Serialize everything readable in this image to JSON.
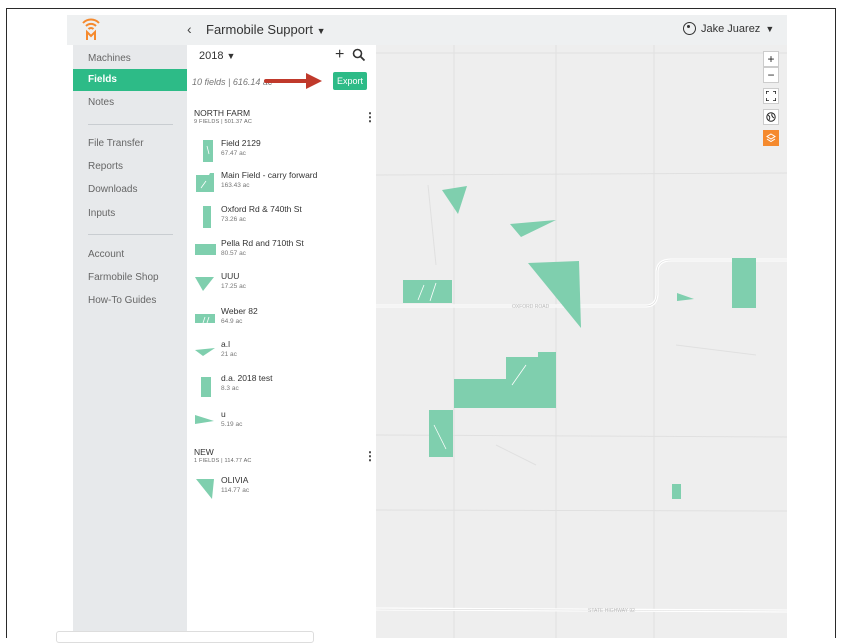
{
  "header": {
    "org_name": "Farmobile Support",
    "user_name": "Jake Juarez",
    "back_icon": "chevron-left-icon",
    "brand_color": "#f58a2e"
  },
  "sidebar": {
    "items": [
      {
        "label": "Machines",
        "active": false
      },
      {
        "label": "Fields",
        "active": true
      },
      {
        "label": "Notes",
        "active": false
      },
      {
        "label": "File Transfer",
        "active": false
      },
      {
        "label": "Reports",
        "active": false
      },
      {
        "label": "Downloads",
        "active": false
      },
      {
        "label": "Inputs",
        "active": false
      },
      {
        "label": "Account",
        "active": false
      },
      {
        "label": "Farmobile Shop",
        "active": false
      },
      {
        "label": "How-To Guides",
        "active": false
      }
    ],
    "active_color": "#2dbb87"
  },
  "fields_panel": {
    "year": "2018",
    "summary": "10 fields | 616.14 ac",
    "export_label": "Export",
    "groups": [
      {
        "title": "NORTH FARM",
        "subtitle": "9 FIELDS | 501.37 AC",
        "fields": [
          {
            "name": "Field 2129",
            "area": "67.47 ac"
          },
          {
            "name": "Main Field - carry forward",
            "area": "163.43 ac"
          },
          {
            "name": "Oxford Rd & 740th St",
            "area": "73.26 ac"
          },
          {
            "name": "Pella Rd and 710th St",
            "area": "80.57 ac"
          },
          {
            "name": "UUU",
            "area": "17.25 ac"
          },
          {
            "name": "Weber 82",
            "area": "64.9 ac"
          },
          {
            "name": "a.l",
            "area": "21 ac"
          },
          {
            "name": "d.a. 2018 test",
            "area": "8.3 ac"
          },
          {
            "name": "u",
            "area": "5.19 ac"
          }
        ]
      },
      {
        "title": "NEW",
        "subtitle": "1 FIELDS | 114.77 AC",
        "fields": [
          {
            "name": "OLIVIA",
            "area": "114.77 ac"
          }
        ]
      }
    ]
  },
  "map": {
    "road_labels": [
      "OXFORD ROAD",
      "STATE HIGHWAY 92"
    ],
    "field_color": "#7fcfae",
    "controls": [
      "zoom-in-icon",
      "zoom-out-icon",
      "fullscreen-icon",
      "globe-icon",
      "layers-icon"
    ]
  }
}
